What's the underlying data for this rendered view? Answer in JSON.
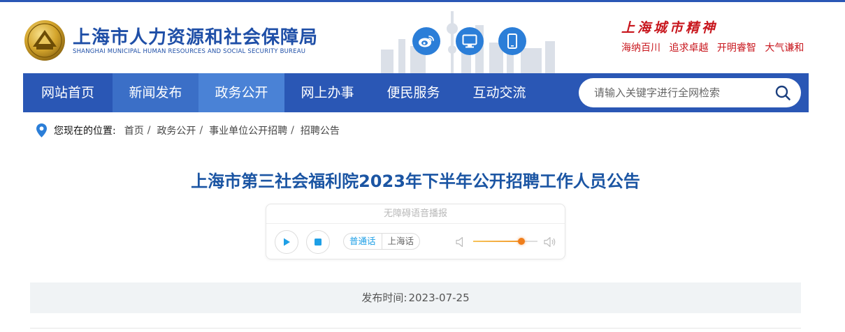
{
  "header": {
    "title": "上海市人力资源和社会保障局",
    "subtitle": "SHANGHAI MUNICIPAL HUMAN RESOURCES AND SOCIAL SECURITY BUREAU",
    "spirit_title": "上海城市精神",
    "spirit_words": [
      "海纳百川",
      "追求卓越",
      "开明睿智",
      "大气谦和"
    ],
    "icons": [
      "weibo-icon",
      "desktop-icon",
      "mobile-icon"
    ]
  },
  "nav": {
    "items": [
      "网站首页",
      "新闻发布",
      "政务公开",
      "网上办事",
      "便民服务",
      "互动交流"
    ],
    "search_placeholder": "请输入关键字进行全网检索"
  },
  "breadcrumb": {
    "label": "您现在的位置:",
    "items": [
      "首页",
      "政务公开",
      "事业单位公开招聘",
      "招聘公告"
    ],
    "separator": "/"
  },
  "article": {
    "title": "上海市第三社会福利院2023年下半年公开招聘工作人员公告",
    "publish_label": "发布时间:",
    "publish_date": "2023-07-25"
  },
  "player": {
    "title": "无障碍语音播报",
    "languages": [
      "普通话",
      "上海话"
    ],
    "selected_language": "普通话",
    "volume": 0.75
  },
  "colors": {
    "nav": "#2a57b5",
    "title": "#1b55a3",
    "spirit": "#c8161d",
    "accent": "#1e9fe6"
  }
}
